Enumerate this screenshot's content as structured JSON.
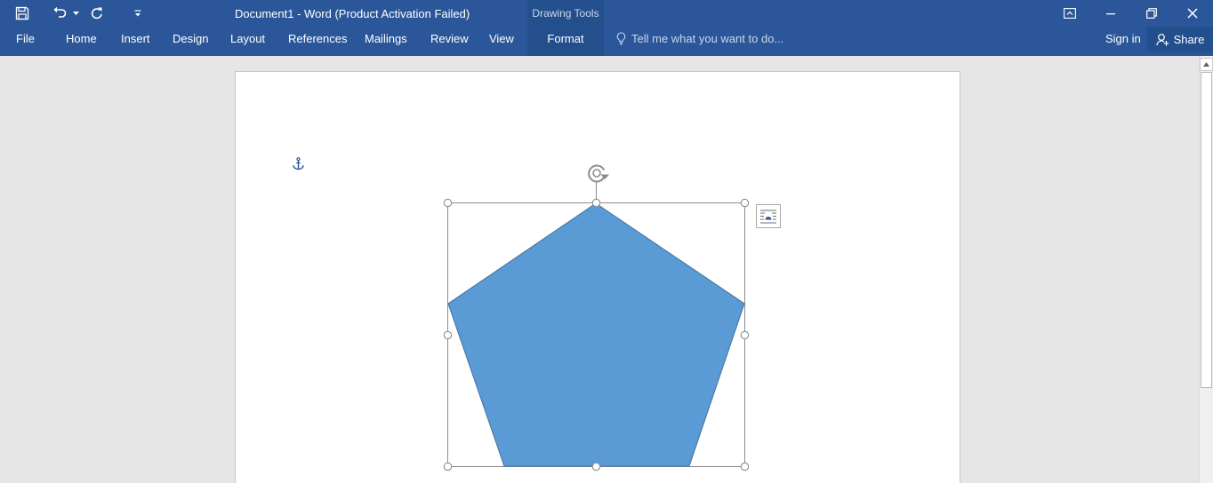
{
  "window": {
    "title": "Document1 - Word (Product Activation Failed)",
    "context_group": "Drawing Tools"
  },
  "quick_access": {
    "icons": [
      "save-icon",
      "undo-icon",
      "undo-dropdown-icon",
      "redo-icon",
      "customize-qat-icon"
    ]
  },
  "window_controls": {
    "icons": [
      "ribbon-display-options-icon",
      "minimize-icon",
      "restore-icon",
      "close-icon"
    ]
  },
  "ribbon": {
    "tabs": [
      {
        "label": "File"
      },
      {
        "label": "Home"
      },
      {
        "label": "Insert"
      },
      {
        "label": "Design"
      },
      {
        "label": "Layout"
      },
      {
        "label": "References"
      },
      {
        "label": "Mailings"
      },
      {
        "label": "Review"
      },
      {
        "label": "View"
      },
      {
        "label": "Format"
      }
    ],
    "active_tab": "Format",
    "tell_me_placeholder": "Tell me what you want to do...",
    "sign_in": "Sign in",
    "share": "Share"
  },
  "shape": {
    "type": "regular-pentagon",
    "fill": "#5b9bd5",
    "outline": "#41719c",
    "selected": true
  },
  "colors": {
    "ribbon": "#2b579a",
    "ribbon_active": "#244f8d",
    "canvas": "#e6e6e6",
    "page": "#ffffff"
  }
}
